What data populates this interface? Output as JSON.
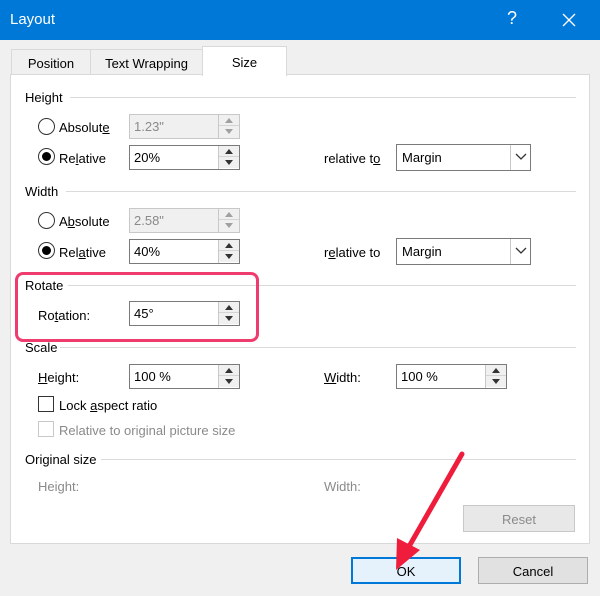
{
  "window": {
    "title": "Layout",
    "help_label": "?"
  },
  "tabs": [
    {
      "label": "Position"
    },
    {
      "label": "Text Wrapping"
    },
    {
      "label": "Size",
      "active": true
    }
  ],
  "height": {
    "section_label": "Height",
    "absolute_label_pre": "Absolut",
    "absolute_label_ul": "e",
    "absolute_value": "1.23\"",
    "relative_label_pre": "Re",
    "relative_label_ul": "l",
    "relative_label_post": "ative",
    "relative_value": "20%",
    "relative_to_pre": "relative t",
    "relative_to_ul": "o",
    "relative_to_value": "Margin",
    "selected": "relative"
  },
  "width": {
    "section_label": "Width",
    "absolute_label_pre": "A",
    "absolute_label_ul": "b",
    "absolute_label_post": "solute",
    "absolute_value": "2.58\"",
    "relative_label_pre": "Rel",
    "relative_label_ul": "a",
    "relative_label_post": "tive",
    "relative_value": "40%",
    "relative_to_pre": "r",
    "relative_to_ul": "e",
    "relative_to_post": "lative to",
    "relative_to_value": "Margin",
    "selected": "relative"
  },
  "rotate": {
    "section_label": "Rotate",
    "rotation_label_pre": "Ro",
    "rotation_label_ul": "t",
    "rotation_label_post": "ation:",
    "rotation_value": "45°"
  },
  "scale": {
    "section_label": "Scale",
    "height_label_pre": "",
    "height_label_ul": "H",
    "height_label_post": "eight:",
    "height_value": "100 %",
    "width_label_pre": "",
    "width_label_ul": "W",
    "width_label_post": "idth:",
    "width_value": "100 %",
    "lock_label_pre": "Lock ",
    "lock_label_ul": "a",
    "lock_label_post": "spect ratio",
    "lock_checked": false,
    "relative_original_label": "Relative to original picture size",
    "relative_original_checked": false
  },
  "original_size": {
    "section_label": "Original size",
    "height_label": "Height:",
    "width_label": "Width:",
    "reset_label": "Reset"
  },
  "buttons": {
    "ok_label": "OK",
    "cancel_label": "Cancel"
  },
  "colors": {
    "title_bar": "#0078d7",
    "highlight": "#ef3c6f",
    "arrow": "#ef1c3c"
  }
}
